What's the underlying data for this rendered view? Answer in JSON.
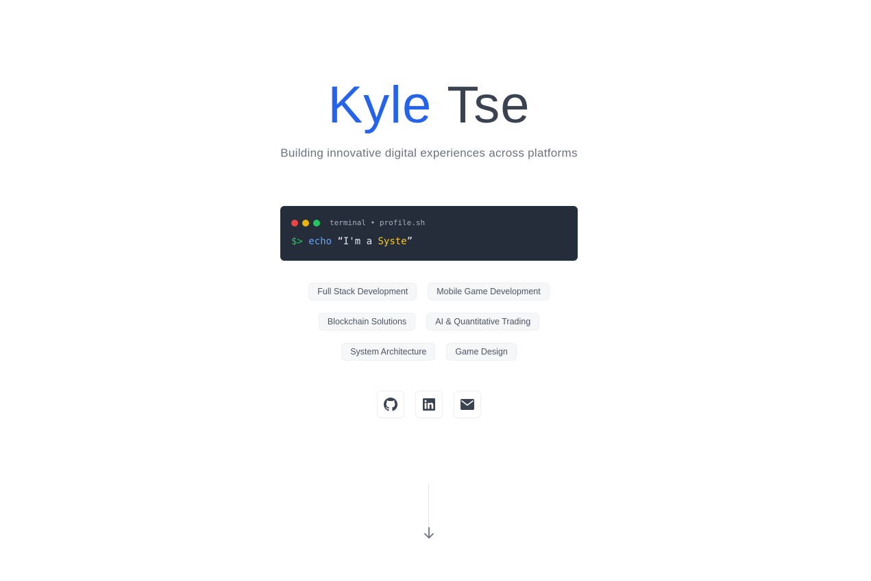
{
  "hero": {
    "first_name": "Kyle",
    "last_name": "Tse",
    "tagline": "Building innovative digital experiences across platforms"
  },
  "terminal": {
    "title": "terminal • profile.sh",
    "prompt": "$>",
    "command": "echo",
    "open_quote": "“I'm a ",
    "typed_text": "Syste",
    "close_quote": "”",
    "dot_colors": [
      "#ef4444",
      "#eab308",
      "#22c55e"
    ]
  },
  "skills": [
    [
      "Full Stack Development",
      "Mobile Game Development"
    ],
    [
      "Blockchain Solutions",
      "AI & Quantitative Trading"
    ],
    [
      "System Architecture",
      "Game Design"
    ]
  ],
  "socials": [
    {
      "icon": "github-icon"
    },
    {
      "icon": "linkedin-icon"
    },
    {
      "icon": "email-icon"
    }
  ],
  "colors": {
    "accent": "#2563eb",
    "terminal_bg": "#252d3b",
    "prompt": "#22c55e",
    "command": "#60a5fa",
    "typed": "#facc15"
  }
}
